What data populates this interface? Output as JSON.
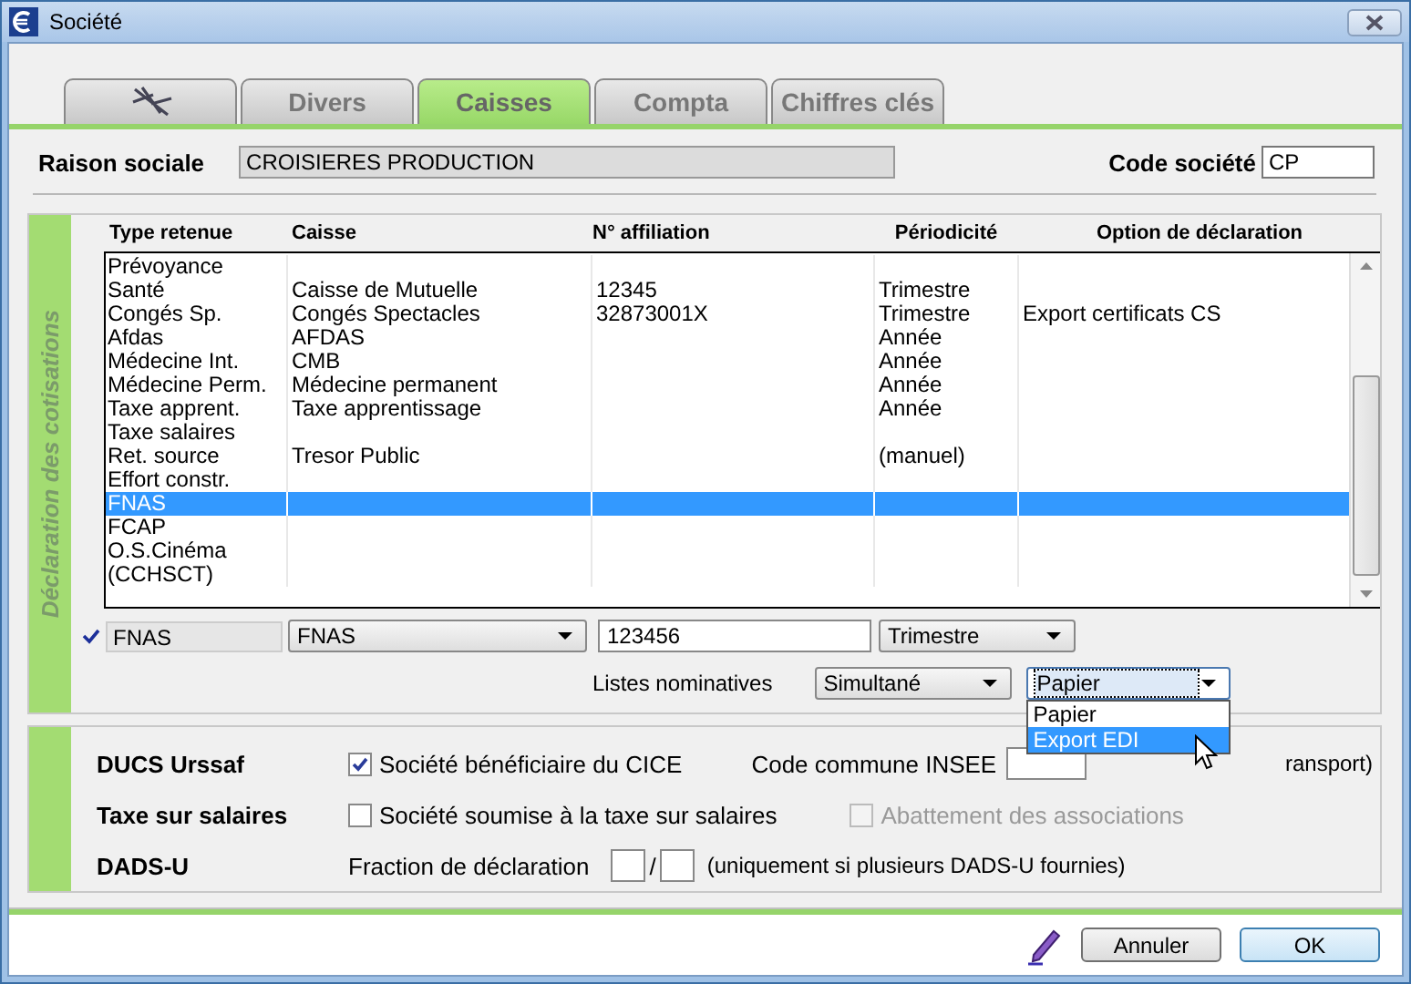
{
  "window": {
    "title": "Société"
  },
  "tabs": [
    {
      "kind": "icon",
      "selected": false
    },
    {
      "kind": "text",
      "label": "Divers",
      "selected": false
    },
    {
      "kind": "text",
      "label": "Caisses",
      "selected": true
    },
    {
      "kind": "text",
      "label": "Compta",
      "selected": false
    },
    {
      "kind": "text",
      "label": "Chiffres clés",
      "selected": false
    }
  ],
  "raison_sociale": {
    "label": "Raison sociale",
    "value": "CROISIERES PRODUCTION"
  },
  "code_societe": {
    "label": "Code société",
    "value": "CP"
  },
  "cotisations": {
    "title": "Déclaration des cotisations",
    "columns": [
      "Type retenue",
      "Caisse",
      "N° affiliation",
      "Périodicité",
      "Option de déclaration"
    ],
    "rows": [
      {
        "type": "Prévoyance",
        "selected": false
      },
      {
        "type": "Santé",
        "caisse": "Caisse de Mutuelle",
        "affiliation": "12345",
        "periodicite": "Trimestre",
        "selected": false
      },
      {
        "type": "Congés Sp.",
        "caisse": "Congés Spectacles",
        "affiliation": "32873001X",
        "periodicite": "Trimestre",
        "option": "Export certificats CS",
        "selected": false
      },
      {
        "type": "Afdas",
        "caisse": "AFDAS",
        "periodicite": "Année",
        "selected": false
      },
      {
        "type": "Médecine Int.",
        "caisse": "CMB",
        "periodicite": "Année",
        "selected": false
      },
      {
        "type": "Médecine Perm.",
        "caisse": "Médecine permanent",
        "periodicite": "Année",
        "selected": false
      },
      {
        "type": "Taxe apprent.",
        "caisse": "Taxe apprentissage",
        "periodicite": "Année",
        "selected": false
      },
      {
        "type": "Taxe salaires",
        "selected": false
      },
      {
        "type": "Ret. source",
        "caisse": "Tresor Public",
        "periodicite": "(manuel)",
        "selected": false
      },
      {
        "type": "Effort constr.",
        "selected": false
      },
      {
        "type": "FNAS",
        "selected": true
      },
      {
        "type": "FCAP",
        "selected": false
      },
      {
        "type": "O.S.Cinéma",
        "selected": false
      },
      {
        "type": "(CCHSCT)",
        "selected": false
      }
    ],
    "editor": {
      "type": "FNAS",
      "caisse": "FNAS",
      "affiliation": "123456",
      "periodicite": "Trimestre"
    },
    "listes": {
      "label": "Listes nominatives",
      "mode": "Simultané",
      "option": "Papier",
      "dropdown": [
        {
          "label": "Papier",
          "selected": false
        },
        {
          "label": "Export EDI",
          "selected": true
        }
      ]
    }
  },
  "ducs": {
    "label": "DUCS Urssaf",
    "checkbox": {
      "label": "Société bénéficiaire du CICE",
      "checked": true
    },
    "insee_label": "Code commune INSEE",
    "note": "ransport)"
  },
  "taxe": {
    "label": "Taxe sur salaires",
    "checkbox": {
      "label": "Société soumise à la taxe sur salaires",
      "checked": false
    },
    "abattement": {
      "label": "Abattement des associations",
      "checked": false,
      "disabled": true
    }
  },
  "dads": {
    "label": "DADS-U",
    "fraction_label": "Fraction de déclaration",
    "separator": "/",
    "note": "(uniquement si plusieurs DADS-U fournies)"
  },
  "buttons": [
    {
      "label": "Annuler",
      "kind": "normal"
    },
    {
      "label": "OK",
      "kind": "default"
    }
  ]
}
